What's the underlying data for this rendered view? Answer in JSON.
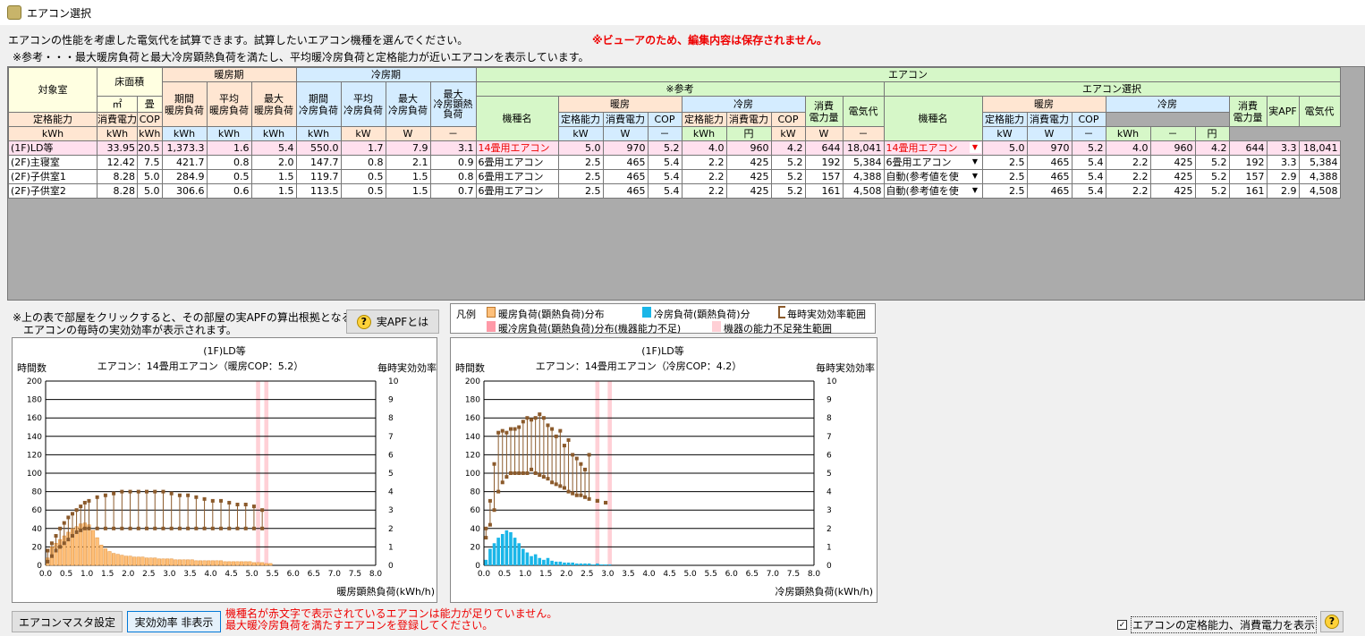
{
  "window": {
    "title": "エアコン選択"
  },
  "intro": {
    "line1": "エアコンの性能を考慮した電気代を試算できます。試算したいエアコン機種を選んでください。",
    "line2": "※参考・・・最大暖房負荷と最大冷房顕熱負荷を満たし、平均暖冷房負荷と定格能力が近いエアコンを表示しています。",
    "warning": "※ビューアのため、編集内容は保存されません。"
  },
  "grid": {
    "h_room": "対象室",
    "h_area": "床面積",
    "h_heating": "暖房期",
    "h_cooling": "冷房期",
    "h_aircon": "エアコン",
    "h_ref": "※参考",
    "h_sel": "エアコン選択",
    "h_model": "機種名",
    "h_hot": "暖房",
    "h_cold": "冷房",
    "h_cons": "消費\n電力量",
    "h_cost": "電気代",
    "h_apf": "実APF",
    "h_period_heat": "期間\n暖房負荷",
    "h_avg_heat": "平均\n暖房負荷",
    "h_max_heat": "最大\n暖房負荷",
    "h_period_cool": "期間\n冷房負荷",
    "h_avg_cool": "平均\n冷房負荷",
    "h_max_cool": "最大\n冷房負荷",
    "h_max_cool_sens": "最大\n冷房顕熱\n負荷",
    "h_rated": "定格能力",
    "h_power": "消費電力",
    "h_cop": "COP",
    "u_m2": "㎡",
    "u_jo": "畳",
    "u_kwh": "kWh",
    "u_kw": "kW",
    "u_w": "W",
    "u_dash": "－",
    "u_yen": "円",
    "rows": [
      {
        "room": "(1F)LD等",
        "m2": "33.95",
        "jo": "20.5",
        "ph": "1,373.3",
        "ah": "1.6",
        "mh": "5.4",
        "pc": "550.0",
        "ac": "1.7",
        "mc": "7.9",
        "ms": "3.1",
        "rmodel": "14畳用エアコン",
        "r1": "5.0",
        "r2": "970",
        "r3": "5.2",
        "r4": "4.0",
        "r5": "960",
        "r6": "4.2",
        "r7": "644",
        "r8": "18,041",
        "smodel": "14畳用エアコン",
        "s1": "5.0",
        "s2": "970",
        "s3": "5.2",
        "s4": "4.0",
        "s5": "960",
        "s6": "4.2",
        "s7": "644",
        "s8": "3.3",
        "s9": "18,041"
      },
      {
        "room": "(2F)主寝室",
        "m2": "12.42",
        "jo": "7.5",
        "ph": "421.7",
        "ah": "0.8",
        "mh": "2.0",
        "pc": "147.7",
        "ac": "0.8",
        "mc": "2.1",
        "ms": "0.9",
        "rmodel": "6畳用エアコン",
        "r1": "2.5",
        "r2": "465",
        "r3": "5.4",
        "r4": "2.2",
        "r5": "425",
        "r6": "5.2",
        "r7": "192",
        "r8": "5,384",
        "smodel": "6畳用エアコン",
        "s1": "2.5",
        "s2": "465",
        "s3": "5.4",
        "s4": "2.2",
        "s5": "425",
        "s6": "5.2",
        "s7": "192",
        "s8": "3.3",
        "s9": "5,384"
      },
      {
        "room": "(2F)子供室1",
        "m2": "8.28",
        "jo": "5.0",
        "ph": "284.9",
        "ah": "0.5",
        "mh": "1.5",
        "pc": "119.7",
        "ac": "0.5",
        "mc": "1.5",
        "ms": "0.8",
        "rmodel": "6畳用エアコン",
        "r1": "2.5",
        "r2": "465",
        "r3": "5.4",
        "r4": "2.2",
        "r5": "425",
        "r6": "5.2",
        "r7": "157",
        "r8": "4,388",
        "smodel": "自動(参考値を使",
        "s1": "2.5",
        "s2": "465",
        "s3": "5.4",
        "s4": "2.2",
        "s5": "425",
        "s6": "5.2",
        "s7": "157",
        "s8": "2.9",
        "s9": "4,388"
      },
      {
        "room": "(2F)子供室2",
        "m2": "8.28",
        "jo": "5.0",
        "ph": "306.6",
        "ah": "0.6",
        "mh": "1.5",
        "pc": "113.5",
        "ac": "0.5",
        "mc": "1.5",
        "ms": "0.7",
        "rmodel": "6畳用エアコン",
        "r1": "2.5",
        "r2": "465",
        "r3": "5.4",
        "r4": "2.2",
        "r5": "425",
        "r6": "5.2",
        "r7": "161",
        "r8": "4,508",
        "smodel": "自動(参考値を使",
        "s1": "2.5",
        "s2": "465",
        "s3": "5.4",
        "s4": "2.2",
        "s5": "425",
        "s6": "5.2",
        "s7": "161",
        "s8": "2.9",
        "s9": "4,508"
      }
    ]
  },
  "note": {
    "line1": "※上の表で部屋をクリックすると、その部屋の実APFの算出根拠となる",
    "line2": "エアコンの毎時の実効効率が表示されます。"
  },
  "apf_button": "実APFとは",
  "legend": {
    "title": "凡例",
    "i1": "暖房負荷(顕熱負荷)分布",
    "i2": "冷房負荷(顕熱負荷)分",
    "i3": "毎時実効効率範囲",
    "i4": "暖冷房負荷(顕熱負荷)分布(機器能力不足)",
    "i5": "機器の能力不足発生範囲"
  },
  "colors": {
    "heat": "#ffc07a",
    "cool": "#1ab6e8",
    "eff": "#8b5a2b",
    "short": "#ffd0d6",
    "shortbar": "#ff9aa8"
  },
  "chart_data": [
    {
      "type": "bar",
      "title": "(1F)LD等",
      "subtitle": "エアコン：14畳用エアコン（暖房COP：5.2）",
      "ylabel": "時間数",
      "y2label": "毎時実効効率",
      "xlabel": "暖房顕熱負荷(kWh/h)",
      "ylim": [
        0,
        200
      ],
      "y2lim": [
        0,
        10
      ],
      "xlim": [
        0,
        8
      ],
      "yticks": [
        "0",
        "20",
        "40",
        "60",
        "80",
        "100",
        "120",
        "140",
        "160",
        "180",
        "200"
      ],
      "y2ticks": [
        "0",
        "1",
        "2",
        "3",
        "4",
        "5",
        "6",
        "7",
        "8",
        "9",
        "10"
      ],
      "xticks": [
        "0.0",
        "0.5",
        "1.0",
        "1.5",
        "2.0",
        "2.5",
        "3.0",
        "3.5",
        "4.0",
        "4.5",
        "5.0",
        "5.5",
        "6.0",
        "6.5",
        "7.0",
        "7.5",
        "8.0"
      ],
      "bin": 0.1,
      "hours": [
        8,
        20,
        24,
        28,
        32,
        36,
        40,
        42,
        45,
        46,
        44,
        38,
        30,
        22,
        18,
        15,
        13,
        12,
        11,
        10,
        10,
        9,
        9,
        9,
        8,
        8,
        8,
        7,
        7,
        7,
        7,
        6,
        6,
        6,
        6,
        6,
        5,
        5,
        5,
        5,
        5,
        5,
        5,
        4,
        4,
        4,
        4,
        4,
        4,
        4,
        3,
        3,
        3,
        2,
        2
      ],
      "eff_x": [
        0.0,
        0.1,
        0.2,
        0.3,
        0.4,
        0.5,
        0.6,
        0.7,
        0.8,
        0.9,
        1.0,
        1.2,
        1.4,
        1.6,
        1.8,
        2.0,
        2.2,
        2.4,
        2.6,
        2.8,
        3.0,
        3.2,
        3.4,
        3.6,
        3.8,
        4.0,
        4.2,
        4.4,
        4.6,
        4.8,
        5.0,
        5.2
      ],
      "eff_min": [
        0.2,
        0.5,
        0.8,
        1.0,
        1.2,
        1.4,
        1.6,
        1.8,
        1.9,
        2.0,
        2.0,
        2.0,
        2.0,
        2.0,
        2.0,
        2.0,
        2.0,
        2.0,
        2.0,
        2.0,
        2.0,
        2.0,
        2.0,
        2.0,
        2.0,
        2.0,
        2.0,
        2.0,
        2.0,
        2.0,
        2.0,
        2.0
      ],
      "eff_max": [
        0.8,
        1.2,
        1.6,
        2.0,
        2.3,
        2.6,
        2.8,
        3.0,
        3.2,
        3.4,
        3.5,
        3.7,
        3.8,
        3.9,
        4.0,
        4.0,
        4.0,
        4.0,
        4.0,
        4.0,
        3.9,
        3.8,
        3.8,
        3.7,
        3.6,
        3.5,
        3.5,
        3.4,
        3.3,
        3.3,
        3.2,
        3.0
      ],
      "shortage": [
        [
          5.1,
          5.2
        ],
        [
          5.3,
          5.4
        ]
      ]
    },
    {
      "type": "bar",
      "title": "(1F)LD等",
      "subtitle": "エアコン：14畳用エアコン（冷房COP：4.2）",
      "ylabel": "時間数",
      "y2label": "毎時実効効率",
      "xlabel": "冷房顕熱負荷(kWh/h)",
      "ylim": [
        0,
        200
      ],
      "y2lim": [
        0,
        10
      ],
      "xlim": [
        0,
        8
      ],
      "yticks": [
        "0",
        "20",
        "40",
        "60",
        "80",
        "100",
        "120",
        "140",
        "160",
        "180",
        "200"
      ],
      "y2ticks": [
        "0",
        "1",
        "2",
        "3",
        "4",
        "5",
        "6",
        "7",
        "8",
        "9",
        "10"
      ],
      "xticks": [
        "0.0",
        "0.5",
        "1.0",
        "1.5",
        "2.0",
        "2.5",
        "3.0",
        "3.5",
        "4.0",
        "4.5",
        "5.0",
        "5.5",
        "6.0",
        "6.5",
        "7.0",
        "7.5",
        "8.0"
      ],
      "bin": 0.1,
      "hours": [
        6,
        18,
        24,
        30,
        34,
        38,
        36,
        30,
        24,
        18,
        14,
        10,
        12,
        8,
        6,
        8,
        5,
        4,
        4,
        3,
        3,
        3,
        2,
        2,
        2,
        2,
        1,
        2,
        1,
        1,
        1
      ],
      "eff_x": [
        0.0,
        0.1,
        0.2,
        0.3,
        0.4,
        0.5,
        0.6,
        0.7,
        0.8,
        0.9,
        1.0,
        1.1,
        1.2,
        1.3,
        1.4,
        1.5,
        1.6,
        1.7,
        1.8,
        1.9,
        2.0,
        2.1,
        2.2,
        2.3,
        2.4,
        2.5,
        2.7,
        2.9
      ],
      "eff_min": [
        1.5,
        2.2,
        3.0,
        4.0,
        4.5,
        4.8,
        5.0,
        5.0,
        5.0,
        5.0,
        5.0,
        5.2,
        5.0,
        4.9,
        4.8,
        4.7,
        4.5,
        4.4,
        4.3,
        4.2,
        4.0,
        3.9,
        3.8,
        3.8,
        3.7,
        3.6,
        3.5,
        3.4
      ],
      "eff_max": [
        2.0,
        3.5,
        5.5,
        7.2,
        7.3,
        7.2,
        7.4,
        7.4,
        7.5,
        7.8,
        8.0,
        7.9,
        8.0,
        8.2,
        8.0,
        7.6,
        7.4,
        7.0,
        7.3,
        6.5,
        6.8,
        6.0,
        5.8,
        5.5,
        5.2,
        6.0,
        3.5,
        3.4
      ],
      "shortage": [
        [
          2.7,
          2.8
        ],
        [
          3.0,
          3.1
        ]
      ]
    }
  ],
  "buttons": {
    "master": "エアコンマスタ設定",
    "toggle": "実効効率 非表示"
  },
  "bottom": {
    "msg1": "機種名が赤文字で表示されているエアコンは能力が足りていません。",
    "msg2": "最大暖冷房負荷を満たすエアコンを登録してください。",
    "checkbox": "エアコンの定格能力、消費電力を表示",
    "help": "?"
  }
}
